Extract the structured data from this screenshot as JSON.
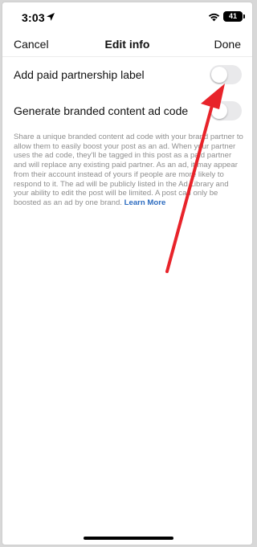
{
  "status_bar": {
    "time": "3:03",
    "battery": "41",
    "icons": [
      "location-arrow-icon",
      "wifi-icon",
      "battery-icon"
    ]
  },
  "nav": {
    "cancel_label": "Cancel",
    "title": "Edit info",
    "done_label": "Done"
  },
  "settings": {
    "paid_partnership": {
      "label": "Add paid partnership label",
      "enabled": false
    },
    "branded_ad_code": {
      "label": "Generate branded content ad code",
      "enabled": false
    }
  },
  "description": {
    "text": "Share a unique branded content ad code with your brand partner to allow them to easily boost your post as an ad. When your partner uses the ad code, they'll be tagged in this post as a paid partner and will replace any existing paid partner. As an ad, it may appear from their account instead of yours if people are more likely to respond to it. The ad will be publicly listed in the Ad Library and your ability to edit the post will be limited. A post can only be boosted as an ad by one brand.",
    "link_label": "Learn More"
  },
  "colors": {
    "link": "#2d6cc0",
    "toggle_off": "#e9e9eb",
    "annotation_arrow": "#e8232a",
    "description_text": "#8e8e8e"
  }
}
